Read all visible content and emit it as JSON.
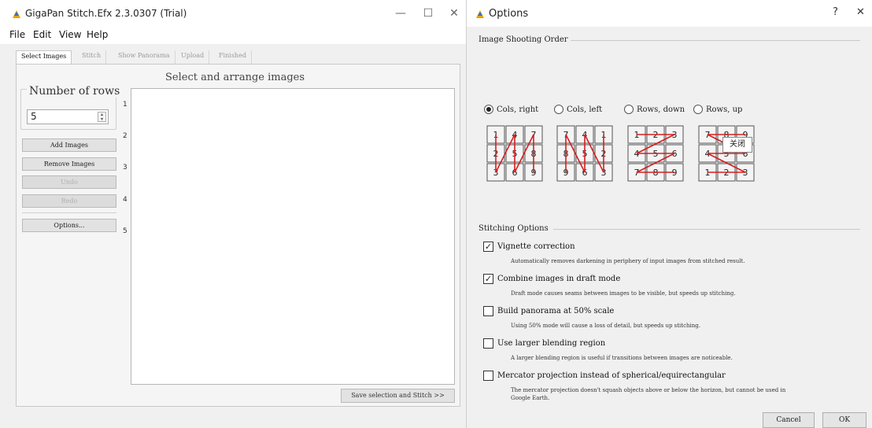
{
  "main_window": {
    "title": "GigaPan Stitch.Efx 2.3.0307 (Trial)",
    "controls": {
      "minimize": "—",
      "maximize": "☐",
      "close": "✕"
    },
    "menu": [
      "File",
      "Edit",
      "View",
      "Help"
    ],
    "tabs": [
      {
        "label": "Select Images",
        "active": true
      },
      {
        "label": "Stitch",
        "active": false
      },
      {
        "label": "Show Panorama",
        "active": false
      },
      {
        "label": "Upload",
        "active": false
      },
      {
        "label": "Finished",
        "active": false
      }
    ],
    "rows_label": "Number of rows",
    "rows_value": "5",
    "buttons": {
      "add_images": "Add Images",
      "remove_images": "Remove Images",
      "undo": "Undo",
      "redo": "Redo",
      "options": "Options..."
    },
    "grid_title": "Select and arrange images",
    "row_numbers": [
      "1",
      "2",
      "3",
      "4",
      "5"
    ],
    "stitch_button": "Save selection and Stitch >>"
  },
  "options_dialog": {
    "title": "Options",
    "help": "?",
    "close": "✕",
    "shooting_order": {
      "label": "Image Shooting Order",
      "options": [
        {
          "label": "Cols, right",
          "selected": true
        },
        {
          "label": "Cols, left",
          "selected": false
        },
        {
          "label": "Rows, down",
          "selected": false
        },
        {
          "label": "Rows, up",
          "selected": false
        }
      ],
      "diagrams": [
        {
          "name": "cols-right",
          "grid": [
            [
              "1",
              "4",
              "7"
            ],
            [
              "2",
              "5",
              "8"
            ],
            [
              "3",
              "6",
              "9"
            ]
          ]
        },
        {
          "name": "cols-left",
          "grid": [
            [
              "7",
              "4",
              "1"
            ],
            [
              "8",
              "5",
              "2"
            ],
            [
              "9",
              "6",
              "3"
            ]
          ]
        },
        {
          "name": "rows-down",
          "grid": [
            [
              "1",
              "2",
              "3"
            ],
            [
              "4",
              "5",
              "6"
            ],
            [
              "7",
              "8",
              "9"
            ]
          ]
        },
        {
          "name": "rows-up",
          "grid": [
            [
              "7",
              "8",
              "9"
            ],
            [
              "4",
              "5",
              "6"
            ],
            [
              "1",
              "2",
              "3"
            ]
          ]
        }
      ]
    },
    "tooltip": "关闭",
    "stitching": {
      "label": "Stitching Options",
      "options": [
        {
          "label": "Vignette correction",
          "checked": true,
          "desc": "Automatically removes darkening in periphery of input images from stitched result."
        },
        {
          "label": "Combine images in draft mode",
          "checked": true,
          "desc": "Draft mode causes seams between images to be visible, but speeds up stitching."
        },
        {
          "label": "Build panorama at 50% scale",
          "checked": false,
          "desc": "Using 50% mode will cause a loss of detail, but speeds up stitching."
        },
        {
          "label": "Use larger blending region",
          "checked": false,
          "desc": "A larger blending region is useful if transitions between images are noticeable."
        },
        {
          "label": "Mercator projection instead of spherical/equirectangular",
          "checked": false,
          "desc_line1": "The mercator projection doesn't squash objects above or below the horizon, but cannot be used in",
          "desc_line2": "Google Earth."
        }
      ]
    },
    "buttons": {
      "cancel": "Cancel",
      "ok": "OK"
    },
    "colors": {
      "arrow": "#d42020",
      "tile_border": "#555555"
    }
  }
}
